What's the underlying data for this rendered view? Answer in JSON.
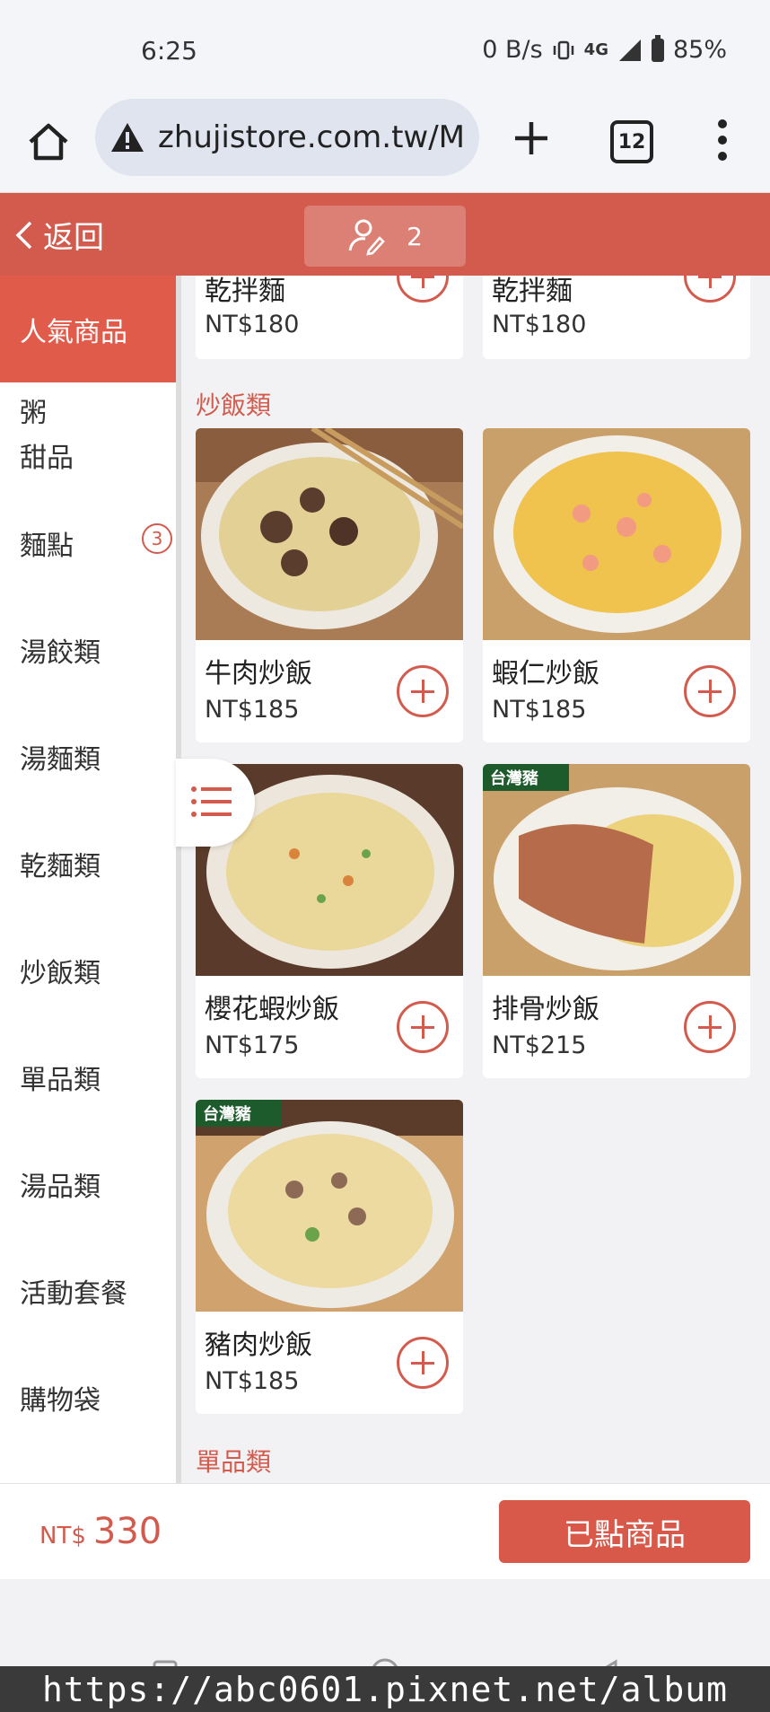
{
  "status_bar": {
    "time": "6:25",
    "net_speed": "0 B/s",
    "network": "4G",
    "battery": "85%"
  },
  "browser": {
    "url": "zhujistore.com.tw/Mc",
    "tab_count": "12"
  },
  "header": {
    "back_label": "返回",
    "people_count": "2"
  },
  "sidebar": {
    "items": [
      {
        "label": "人氣商品",
        "active": true
      },
      {
        "label": "粥\n甜品"
      },
      {
        "label": "麵點",
        "badge": "3"
      },
      {
        "label": "湯餃類"
      },
      {
        "label": "湯麵類"
      },
      {
        "label": "乾麵類"
      },
      {
        "label": "炒飯類"
      },
      {
        "label": "單品類"
      },
      {
        "label": "湯品類"
      },
      {
        "label": "活動套餐"
      },
      {
        "label": "購物袋"
      }
    ]
  },
  "top_cards": [
    {
      "name": "乾拌麵",
      "price": "NT$180"
    },
    {
      "name": "乾拌麵",
      "price": "NT$180"
    }
  ],
  "section_fried_rice": {
    "title": "炒飯類",
    "items": [
      {
        "name": "牛肉炒飯",
        "price": "NT$185"
      },
      {
        "name": "蝦仁炒飯",
        "price": "NT$185"
      },
      {
        "name": "櫻花蝦炒飯",
        "price": "NT$175"
      },
      {
        "name": "排骨炒飯",
        "price": "NT$215"
      },
      {
        "name": "豬肉炒飯",
        "price": "NT$185"
      }
    ]
  },
  "section_next": {
    "title": "單品類"
  },
  "footer": {
    "currency": "NT$",
    "total": "330",
    "ordered_label": "已點商品"
  },
  "badges": {
    "taiwan_pork": "台灣豬"
  },
  "watermark": "https://abc0601.pixnet.net/album",
  "colors": {
    "accent": "#d25b4d",
    "header_bg": "#d25b4d"
  }
}
